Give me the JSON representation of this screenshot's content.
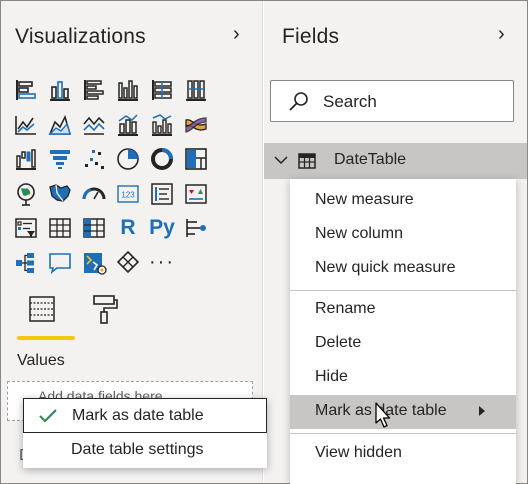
{
  "visualizations": {
    "title": "Visualizations",
    "icons": [
      "stacked-bar-chart-icon",
      "stacked-column-chart-icon",
      "clustered-bar-chart-icon",
      "clustered-column-chart-icon",
      "100-stacked-bar-chart-icon",
      "100-stacked-column-chart-icon",
      "blank",
      "line-chart-icon",
      "area-chart-icon",
      "stacked-area-chart-icon",
      "line-and-stacked-column-chart-icon",
      "line-and-clustered-column-chart-icon",
      "ribbon-chart-icon",
      "blank",
      "waterfall-chart-icon",
      "funnel-chart-icon",
      "scatter-chart-icon",
      "pie-chart-icon",
      "donut-chart-icon",
      "treemap-icon",
      "blank",
      "map-icon",
      "filled-map-icon",
      "gauge-icon",
      "card-icon",
      "multi-row-card-icon",
      "kpi-icon",
      "blank",
      "slicer-icon",
      "table-icon",
      "matrix-icon",
      "r-script-visual-icon",
      "python-visual-icon",
      "key-influencers-icon",
      "blank",
      "decomposition-tree-icon",
      "qa-icon",
      "smart-narrative-icon",
      "power-apps-icon",
      "more-visuals-icon"
    ],
    "r_label": "R",
    "py_label": "Py",
    "more_label": "···",
    "values_label": "Values",
    "drop_placeholder": "Add data fields here"
  },
  "fields": {
    "title": "Fields",
    "search_placeholder": "Search",
    "table_name": "DateTable"
  },
  "context_menu": {
    "items": [
      "New measure",
      "New column",
      "New quick measure",
      "Rename",
      "Delete",
      "Hide",
      "Mark as date table",
      "View hidden"
    ]
  },
  "submenu": {
    "items": [
      "Mark as date table",
      "Date table settings"
    ]
  },
  "colors": {
    "pane_background": "#f3f2f1",
    "accent_yellow": "#f2c811",
    "hover_gray": "#c8c6c4",
    "icon_blue": "#1e6fb8",
    "check_green": "#2e8b57"
  }
}
